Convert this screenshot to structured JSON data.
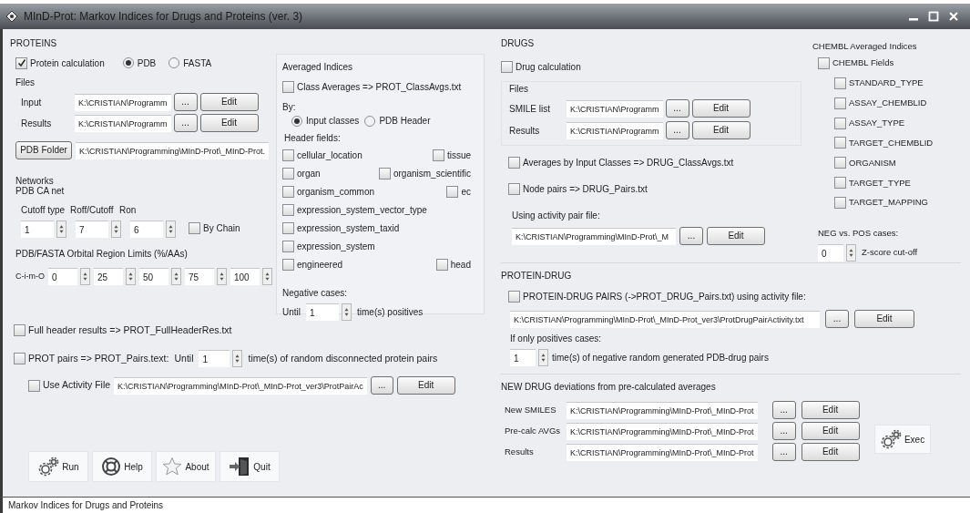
{
  "window": {
    "title": "MInD-Prot: Markov Indices for Drugs and Proteins (ver. 3)"
  },
  "proteins": {
    "heading": "PROTEINS",
    "protein_calculation": {
      "label": "Protein calculation",
      "checked": true
    },
    "format_options": [
      {
        "label": "PDB",
        "selected": true
      },
      {
        "label": "FASTA",
        "selected": false
      }
    ],
    "files": {
      "heading": "Files",
      "rows": [
        {
          "label": "Input",
          "value": "K:\\CRISTIAN\\Programm",
          "browse": "...",
          "edit": "Edit"
        },
        {
          "label": "Results",
          "value": "K:\\CRISTIAN\\Programm",
          "browse": "...",
          "edit": "Edit"
        }
      ]
    },
    "pdb_folder": {
      "button": "PDB Folder",
      "value": "K:\\CRISTIAN\\Programming\\MInD-Prot\\_MInD-Prot."
    },
    "networks": {
      "heading": "Networks",
      "subheading": "PDB CA net",
      "spinners": [
        {
          "label": "Cutoff type",
          "value": "1"
        },
        {
          "label": "Roff/Cutoff",
          "value": "7"
        },
        {
          "label": "Ron",
          "value": "6"
        }
      ],
      "by_chain": {
        "label": "By Chain",
        "checked": false
      }
    },
    "orbital": {
      "heading": "PDB/FASTA Orbital Region Limits (%/AAs)",
      "label": "C-i-m-O",
      "values": [
        "0",
        "25",
        "50",
        "75",
        "100"
      ]
    },
    "averaged_indices": {
      "heading": "Averaged Indices",
      "class_averages": {
        "label": "Class Averages => PROT_ClassAvgs.txt",
        "checked": false
      },
      "by_label": "By:",
      "by_options": [
        {
          "label": "Input classes",
          "selected": true
        },
        {
          "label": "PDB Header",
          "selected": false
        }
      ],
      "header_fields_label": "Header fields:",
      "header_fields": [
        {
          "fields": [
            {
              "label": "cellular_location",
              "checked": false
            },
            {
              "label": "tissue",
              "checked": false
            }
          ]
        },
        {
          "fields": [
            {
              "label": "organ",
              "checked": false
            },
            {
              "label": "organism_scientific",
              "checked": false
            }
          ]
        },
        {
          "fields": [
            {
              "label": "organism_common",
              "checked": false
            },
            {
              "label": "ec",
              "checked": false
            }
          ]
        },
        {
          "fields": [
            {
              "label": "expression_system_vector_type",
              "checked": false
            }
          ]
        },
        {
          "fields": [
            {
              "label": "expression_system_taxid",
              "checked": false
            }
          ]
        },
        {
          "fields": [
            {
              "label": "expression_system",
              "checked": false
            }
          ]
        },
        {
          "fields": [
            {
              "label": "engineered",
              "checked": false
            },
            {
              "label": "head",
              "checked": false
            }
          ]
        }
      ],
      "negative_cases": {
        "heading": "Negative cases:",
        "prefix": "Until",
        "value": "1",
        "suffix": "time(s) positives"
      }
    },
    "full_header": {
      "label": "Full header results => PROT_FullHeaderRes.txt",
      "checked": false
    },
    "prot_pairs": {
      "label": "PROT pairs => PROT_Pairs.text:",
      "until": "Until",
      "value": "1",
      "suffix": "time(s) of random disconnected protein pairs",
      "checked": false
    },
    "activity_file": {
      "label": "Use Activity File",
      "checked": false,
      "value": "K:\\CRISTIAN\\Programming\\MInD-Prot\\_MInD-Prot_ver3\\ProtPairAc",
      "browse": "...",
      "edit": "Edit"
    }
  },
  "actions": [
    {
      "label": "Run",
      "kind": "gears"
    },
    {
      "label": "Help",
      "kind": "lifebuoy"
    },
    {
      "label": "About",
      "kind": "star"
    },
    {
      "label": "Quit",
      "kind": "exit"
    }
  ],
  "drugs": {
    "heading": "DRUGS",
    "drug_calculation": {
      "label": "Drug calculation",
      "checked": false
    },
    "files": {
      "heading": "Files",
      "rows": [
        {
          "label": "SMILE list",
          "value": "K:\\CRISTIAN\\Programm",
          "browse": "...",
          "edit": "Edit"
        },
        {
          "label": "Results",
          "value": "K:\\CRISTIAN\\Programm",
          "browse": "...",
          "edit": "Edit"
        }
      ]
    },
    "averages": {
      "label": "Averages by Input Classes => DRUG_ClassAvgs.txt",
      "checked": false
    },
    "node_pairs": {
      "label": "Node pairs => DRUG_Pairs.txt",
      "checked": false
    },
    "activity": {
      "label": "Using activity pair file:",
      "value": "K:\\CRISTIAN\\Programming\\MInD-Prot\\_M",
      "browse": "...",
      "edit": "Edit"
    },
    "chembl": {
      "heading": "CHEMBL Averaged Indices",
      "fields": {
        "label": "CHEMBL Fields",
        "checked": false
      },
      "items": [
        {
          "label": "STANDARD_TYPE",
          "checked": false
        },
        {
          "label": "ASSAY_CHEMBLID",
          "checked": false
        },
        {
          "label": "ASSAY_TYPE",
          "checked": false
        },
        {
          "label": "TARGET_CHEMBLID",
          "checked": false
        },
        {
          "label": "ORGANISM",
          "checked": false
        },
        {
          "label": "TARGET_TYPE",
          "checked": false
        },
        {
          "label": "TARGET_MAPPING",
          "checked": false
        }
      ],
      "neg_pos": {
        "heading": "NEG vs. POS cases:",
        "value": "0",
        "label": "Z-score cut-off"
      }
    }
  },
  "protein_drug": {
    "heading": "PROTEIN-DRUG",
    "pairs": {
      "label": "PROTEIN-DRUG PAIRS (->PROT_DRUG_Pairs.txt) using activity file:",
      "checked": false
    },
    "value": "K:\\CRISTIAN\\Programming\\MInD-Prot\\_MInD-Prot_ver3\\ProtDrugPairActivity.txt",
    "browse": "...",
    "edit": "Edit",
    "positives_label": "If only positives cases:",
    "positives_value": "1",
    "positives_suffix": "time(s) of negative random generated PDB-drug pairs"
  },
  "new_drug": {
    "heading": "NEW DRUG deviations from pre-calculated averages",
    "rows": [
      {
        "label": "New SMILES",
        "value": "K:\\CRISTIAN\\Programming\\MInD-Prot\\_MInD-Prot",
        "browse": "...",
        "edit": "Edit"
      },
      {
        "label": "Pre-calc AVGs",
        "value": "K:\\CRISTIAN\\Programming\\MInD-Prot\\_MInD-Prot",
        "browse": "...",
        "edit": "Edit"
      },
      {
        "label": "Results",
        "value": "K:\\CRISTIAN\\Programming\\MInD-Prot\\_MInD-Prot",
        "browse": "...",
        "edit": "Edit"
      }
    ],
    "exec": {
      "label": "Exec",
      "kind": "gears"
    }
  },
  "status_bar": "Markov Indices for Drugs and Proteins"
}
